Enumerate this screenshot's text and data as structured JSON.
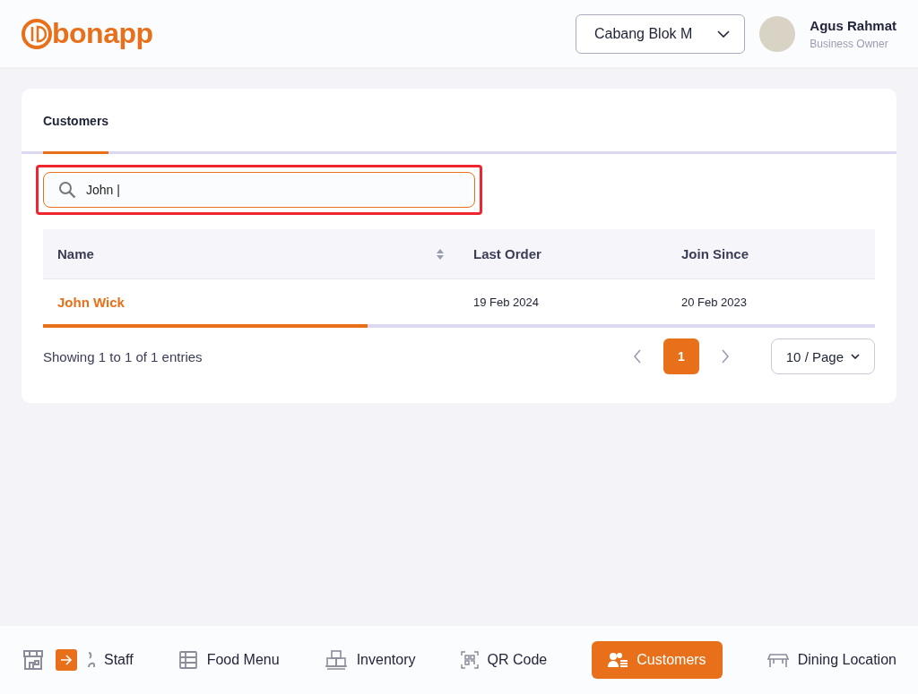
{
  "header": {
    "logo": "bonapp",
    "branch": "Cabang Blok M",
    "user": {
      "name": "Agus Rahmat",
      "role": "Business Owner"
    }
  },
  "tabs": [
    {
      "label": "Customers",
      "selected": true
    }
  ],
  "search": {
    "value": "John |",
    "highlighted": true
  },
  "table": {
    "columns": [
      {
        "label": "Name",
        "sortable": true
      },
      {
        "label": "Last Order",
        "sortable": false
      },
      {
        "label": "Join Since",
        "sortable": false
      }
    ],
    "rows": [
      {
        "cells": [
          "John Wick",
          "19 Feb 2024",
          "20 Feb 2023"
        ]
      }
    ]
  },
  "footer": {
    "summary": "Showing 1 to 1 of 1 entries",
    "pages": [
      {
        "label": "1",
        "selected": true
      }
    ],
    "page_size": "10 / Page"
  },
  "bottom_nav": [
    {
      "kind": "store"
    },
    {
      "kind": "scroll"
    },
    {
      "kind": "item",
      "label": "Staff",
      "selected": false
    },
    {
      "kind": "item",
      "label": "Food Menu",
      "selected": false
    },
    {
      "kind": "item",
      "label": "Inventory",
      "selected": false
    },
    {
      "kind": "item",
      "label": "QR Code",
      "selected": false
    },
    {
      "kind": "item",
      "label": "Customers",
      "selected": true
    },
    {
      "kind": "item",
      "label": "Dining Location",
      "selected": false
    }
  ]
}
